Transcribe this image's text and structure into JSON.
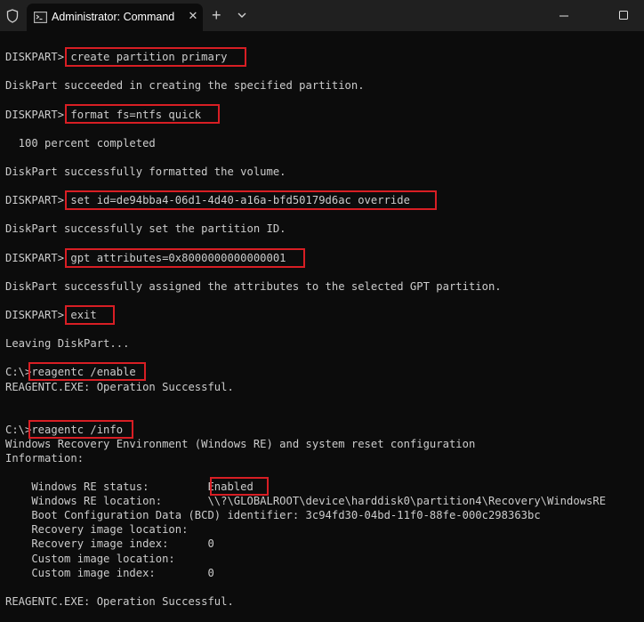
{
  "window": {
    "tab_title": "Administrator: Command Pro",
    "close_glyph": "✕",
    "new_tab_glyph": "+"
  },
  "console": {
    "lines": [
      "DISKPART> create partition primary",
      "DiskPart succeeded in creating the specified partition.",
      "DISKPART> format fs=ntfs quick",
      "  100 percent completed",
      "DiskPart successfully formatted the volume.",
      "DISKPART> set id=de94bba4-06d1-4d40-a16a-bfd50179d6ac override",
      "DiskPart successfully set the partition ID.",
      "DISKPART> gpt attributes=0x8000000000000001",
      "DiskPart successfully assigned the attributes to the selected GPT partition.",
      "DISKPART> exit",
      "Leaving DiskPart...",
      "C:\\>reagentc /enable",
      "REAGENTC.EXE: Operation Successful.",
      "C:\\>reagentc /info",
      "Windows Recovery Environment (Windows RE) and system reset configuration",
      "Information:",
      "    Windows RE status:         Enabled",
      "    Windows RE location:       \\\\?\\GLOBALROOT\\device\\harddisk0\\partition4\\Recovery\\WindowsRE",
      "    Boot Configuration Data (BCD) identifier: 3c94fd30-04bd-11f0-88fe-000c298363bc",
      "    Recovery image location:",
      "    Recovery image index:      0",
      "    Custom image location:",
      "    Custom image index:        0",
      "REAGENTC.EXE: Operation Successful."
    ]
  },
  "colors": {
    "background": "#0c0c0c",
    "text": "#cccccc",
    "titlebar": "#202020",
    "highlight": "#d81e24"
  }
}
